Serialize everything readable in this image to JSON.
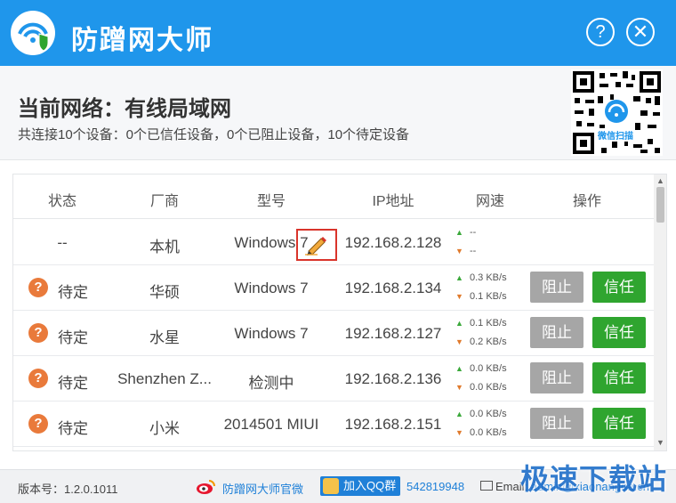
{
  "app": {
    "title": "防蹭网大师"
  },
  "titlebar": {
    "help_label": "?",
    "close_label": "✕"
  },
  "network": {
    "title": "当前网络：有线局域网",
    "summary": "共连接10个设备：0个已信任设备，0个已阻止设备，10个待定设备"
  },
  "qr": {
    "label": "微信扫描"
  },
  "table": {
    "headers": [
      "状态",
      "厂商",
      "型号",
      "IP地址",
      "网速",
      "操作"
    ],
    "rows": [
      {
        "status": "--",
        "vendor": "本机",
        "model": "Windows 7",
        "ip": "192.168.2.128",
        "up": "--",
        "down": "--"
      },
      {
        "status": "待定",
        "vendor": "华硕",
        "model": "Windows 7",
        "ip": "192.168.2.134",
        "up": "0.3 KB/s",
        "down": "0.1 KB/s"
      },
      {
        "status": "待定",
        "vendor": "水星",
        "model": "Windows 7",
        "ip": "192.168.2.127",
        "up": "0.1 KB/s",
        "down": "0.2 KB/s"
      },
      {
        "status": "待定",
        "vendor": "Shenzhen Z...",
        "model": "检测中",
        "ip": "192.168.2.136",
        "up": "0.0 KB/s",
        "down": "0.0 KB/s"
      },
      {
        "status": "待定",
        "vendor": "小米",
        "model": "2014501 MIUI",
        "ip": "192.168.2.151",
        "up": "0.0 KB/s",
        "down": "0.0 KB/s"
      }
    ],
    "block_label": "阻止",
    "trust_label": "信任",
    "status_icon": "?"
  },
  "footer": {
    "version": "版本号：1.2.0.1011",
    "weibo": "防蹭网大师官微",
    "qq_button": "加入QQ群",
    "qq_number": "542819948",
    "email_label": "Email:",
    "email_addr": "admin@xiaonangua.cn"
  },
  "watermark": "极速下载站",
  "colors": {
    "brand": "#1f96eb",
    "trust": "#2fa52f",
    "block": "#a6a6a6",
    "pending": "#e97a3b"
  }
}
